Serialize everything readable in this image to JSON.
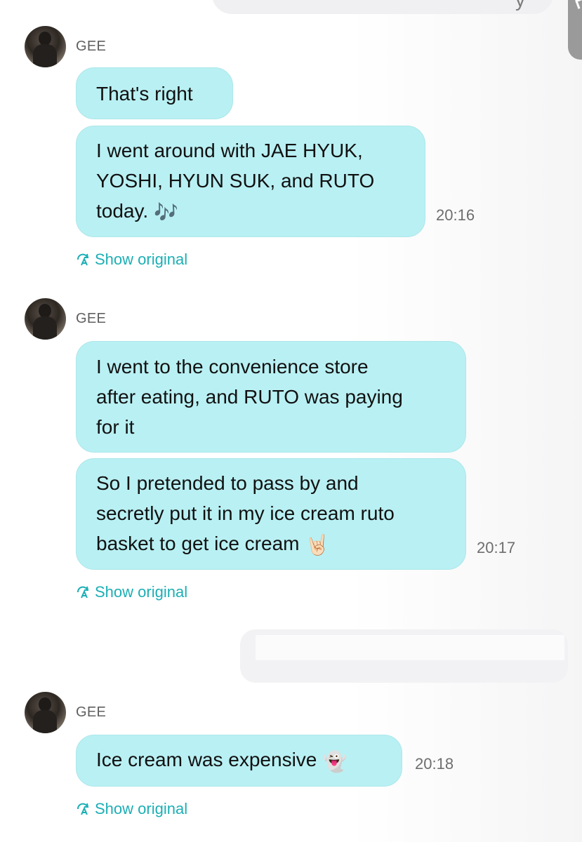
{
  "colors": {
    "bubble_bg": "#b9f0f3",
    "link": "#1cafb5",
    "timestamp": "#6e6e6e",
    "sender": "#5f5f5f"
  },
  "top": {
    "partial_text": "y"
  },
  "groups": [
    {
      "sender": "GEE",
      "avatar_icon": "avatar-photo",
      "messages": [
        {
          "text": "That's right"
        },
        {
          "text": "I went around with JAE HYUK,\nYOSHI, HYUN SUK, and RUTO\ntoday.",
          "emoji": "🎶"
        }
      ],
      "time": "20:16",
      "show_original": "Show original"
    },
    {
      "sender": "GEE",
      "avatar_icon": "avatar-photo",
      "messages": [
        {
          "text": "I went to the convenience store\nafter eating, and RUTO was paying\nfor it"
        },
        {
          "text": "So I pretended to pass by and\nsecretly put it in my ice cream ruto\nbasket to get ice cream",
          "emoji": "🤘🏻"
        }
      ],
      "time": "20:17",
      "show_original": "Show original"
    },
    {
      "sender": "GEE",
      "avatar_icon": "avatar-photo",
      "messages": [
        {
          "text": "Ice cream was expensive",
          "emoji": "👻"
        }
      ],
      "time": "20:18",
      "show_original": "Show original"
    }
  ]
}
